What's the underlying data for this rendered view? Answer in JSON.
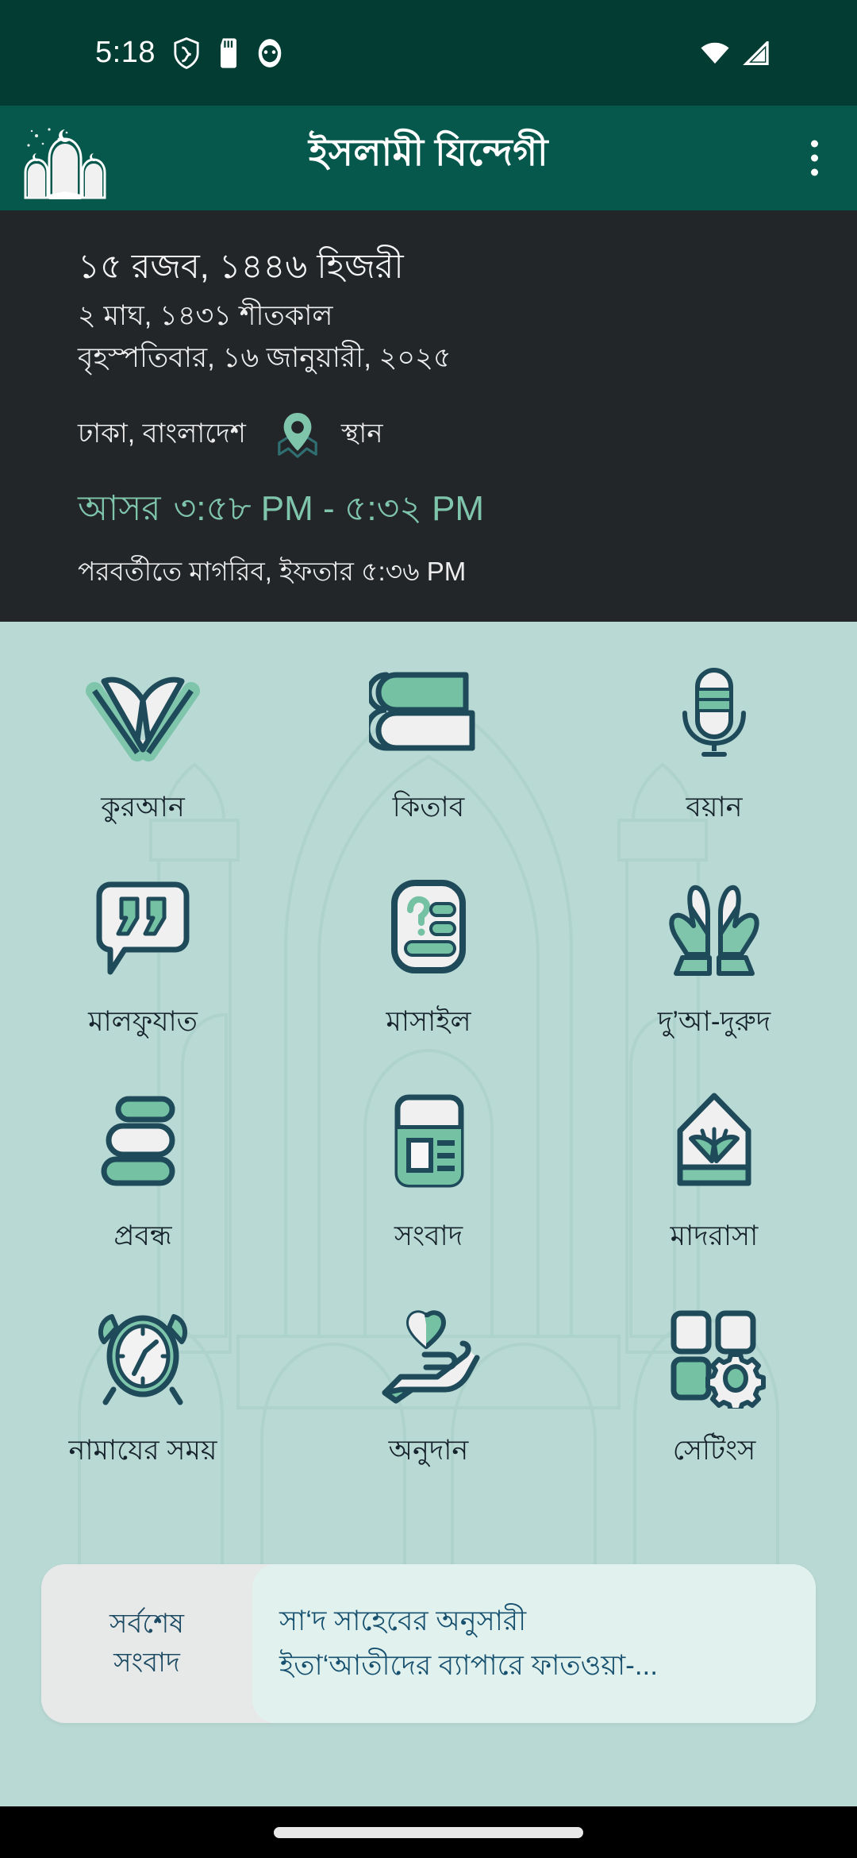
{
  "status_bar": {
    "time": "5:18",
    "icons": [
      "shield-icon",
      "sd-card-icon",
      "app-notification-icon"
    ],
    "right_icons": [
      "wifi-icon",
      "cellular-signal-icon"
    ]
  },
  "app_bar": {
    "title": "ইসলামী যিন্দেগী",
    "logo": "mosque-logo",
    "overflow_menu": "overflow-menu-icon",
    "background_color": "#07584c"
  },
  "info_panel": {
    "hijri_date": "১৫ রজব, ১৪৪৬ হিজরী",
    "bangla_date": "২ মাঘ, ১৪৩১ শীতকাল",
    "gregorian_date": "বৃহস্পতিবার, ১৬ জানুয়ারী, ২০২৫",
    "location_name": "ঢাকা, বাংলাদেশ",
    "location_icon": "map-pin-icon",
    "location_label": "স্থান",
    "prayer_name": "আসর",
    "prayer_range": "৩:৫৮ PM - ৫:৩২ PM",
    "next_prayer": "পরবর্তীতে মাগরিব, ইফতার ৫:৩৬ PM",
    "background_color": "#232629",
    "accent_color": "#7fc5ac"
  },
  "grid": {
    "background_color": "#b9d9d4",
    "items": [
      {
        "label": "কুরআন",
        "icon": "open-quran-icon"
      },
      {
        "label": "কিতাব",
        "icon": "books-stack-icon"
      },
      {
        "label": "বয়ান",
        "icon": "microphone-icon"
      },
      {
        "label": "মালফুযাত",
        "icon": "quote-bubble-icon"
      },
      {
        "label": "মাসাইল",
        "icon": "question-card-icon"
      },
      {
        "label": "দু’আ-দুরুদ",
        "icon": "praying-hands-icon"
      },
      {
        "label": "প্রবন্ধ",
        "icon": "article-stack-icon"
      },
      {
        "label": "সংবাদ",
        "icon": "newspaper-icon"
      },
      {
        "label": "মাদরাসা",
        "icon": "madrasa-arch-icon"
      },
      {
        "label": "নামাযের সময়",
        "icon": "alarm-clock-icon"
      },
      {
        "label": "অনুদান",
        "icon": "donation-hand-heart-icon"
      },
      {
        "label": "সেটিংস",
        "icon": "settings-grid-gear-icon"
      }
    ]
  },
  "news_ticker": {
    "label_line1": "সর্বশেষ",
    "label_line2": "সংবাদ",
    "headline_line1": "সা‘দ সাহেবের অনুসারী",
    "headline_line2": "ইতা‘আতীদের ব্যাপারে ফাতওয়া-..."
  },
  "nav_bar": {
    "gesture_handle": "home-gesture-pill"
  }
}
